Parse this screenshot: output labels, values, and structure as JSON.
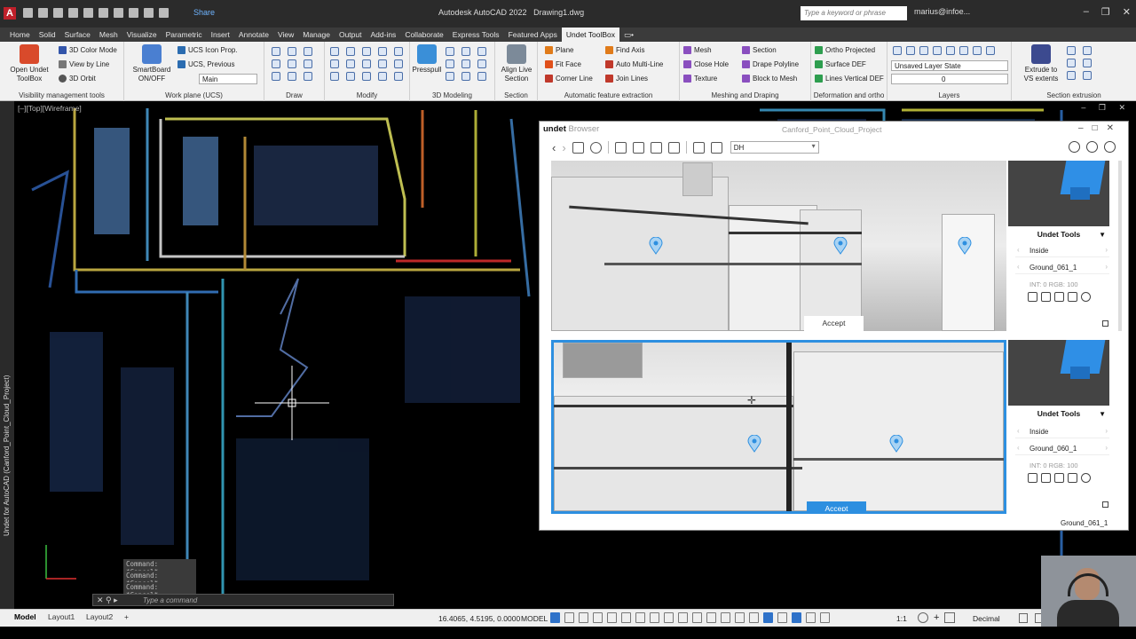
{
  "app": {
    "logo": "A",
    "share_label": "Share",
    "window_title": "Autodesk AutoCAD 2022",
    "drawing_name": "Drawing1.dwg",
    "search_placeholder": "Type a keyword or phrase",
    "user": "marius@infoe..."
  },
  "tabs": [
    "Home",
    "Solid",
    "Surface",
    "Mesh",
    "Visualize",
    "Parametric",
    "Insert",
    "Annotate",
    "View",
    "Manage",
    "Output",
    "Add-ins",
    "Collaborate",
    "Express Tools",
    "Featured Apps",
    "Undet ToolBox"
  ],
  "active_tab": "Undet ToolBox",
  "ribbon": {
    "open_undet": "Open Undet ToolBox",
    "color_mode": "3D Color Mode",
    "view_by_line": "View by Line",
    "orbit": "3D Orbit",
    "visibility_label": "Visibility management tools",
    "smartboard": "SmartBoard ON/OFF",
    "ucs_icon": "UCS Icon Prop.",
    "ucs_prev": "UCS, Previous",
    "ucs_main": "Main",
    "workplane_label": "Work plane (UCS)",
    "draw_label": "Draw",
    "modify_label": "Modify",
    "presspull": "Presspull",
    "modeling_label": "3D Modeling",
    "align_live": "Align Live Section",
    "section_label": "Section",
    "plane": "Plane",
    "fit_face": "Fit Face",
    "corner_line": "Corner Line",
    "find_axis": "Find Axis",
    "auto_multiline": "Auto Multi-Line",
    "join_lines": "Join Lines",
    "auto_feature_label": "Automatic feature extraction",
    "mesh": "Mesh",
    "close_hole": "Close Hole",
    "texture": "Texture",
    "section": "Section",
    "drape_polyline": "Drape Polyline",
    "block_to_mesh": "Block to Mesh",
    "meshing_label": "Meshing and Draping",
    "ortho_projected": "Ortho Projected",
    "surface_def": "Surface DEF",
    "lines_vertical_def": "Lines Vertical DEF",
    "deformation_label": "Deformation and ortho",
    "layer_state": "Unsaved Layer State",
    "layer_current": "0",
    "layers_label": "Layers",
    "extrude": "Extrude to VS extents",
    "section_extrusion_label": "Section extrusion"
  },
  "viewport": {
    "label": "[–][Top][Wireframe]",
    "side_label": "Undet for AutoCAD (Canford_Point_Cloud_Project)",
    "command_history": [
      "Command: *Cancel*",
      "Command: *Cancel*",
      "Command: *Cancel*"
    ],
    "command_placeholder": "Type a command"
  },
  "browser": {
    "brand": "undet",
    "brand_sub": "Browser",
    "project": "Canford_Point_Cloud_Project",
    "dataset": "DH",
    "panels": [
      {
        "accept": "Accept",
        "tools_title": "Undet Tools",
        "mode": "Inside",
        "station": "Ground_061_1",
        "int_rgb": "INT: 0  RGB: 100"
      },
      {
        "accept": "Accept",
        "tools_title": "Undet Tools",
        "mode": "Inside",
        "station": "Ground_060_1",
        "int_rgb": "INT: 0  RGB: 100"
      }
    ],
    "footer": "Ground_061_1"
  },
  "status": {
    "tabs": [
      "Model",
      "Layout1",
      "Layout2"
    ],
    "coords": "16.4065, 4.5195, 0.0000",
    "space": "MODEL",
    "scale": "1:1",
    "units": "Decimal"
  },
  "colors": {
    "accent": "#2d8fe0",
    "ribbon_bg": "#f1f1f1",
    "title_bg": "#2b2b2b"
  }
}
